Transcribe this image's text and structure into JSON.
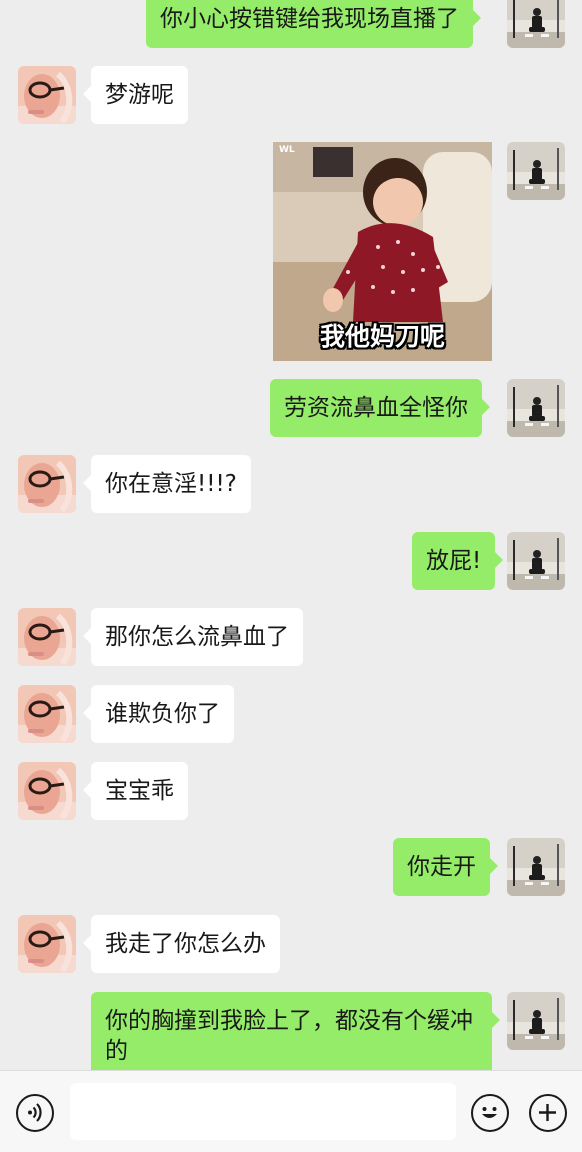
{
  "chat": {
    "messages": [
      {
        "side": "out",
        "text": "你小心按错键给我现场直播了"
      },
      {
        "side": "in",
        "text": "梦游呢"
      },
      {
        "side": "out",
        "type": "sticker",
        "caption": "我他妈刀呢",
        "watermark": "WL"
      },
      {
        "side": "out",
        "text": "劳资流鼻血全怪你"
      },
      {
        "side": "in",
        "text": "你在意淫!!!?"
      },
      {
        "side": "out",
        "text": "放屁!"
      },
      {
        "side": "in",
        "text": "那你怎么流鼻血了"
      },
      {
        "side": "in",
        "text": "谁欺负你了"
      },
      {
        "side": "in",
        "text": "宝宝乖"
      },
      {
        "side": "out",
        "text": "你走开"
      },
      {
        "side": "in",
        "text": "我走了你怎么办"
      },
      {
        "side": "out",
        "text": "你的胸撞到我脸上了，都没有个缓冲的"
      }
    ]
  },
  "input_bar": {
    "voice_icon": "voice-icon",
    "emoji_icon": "emoji-icon",
    "plus_icon": "plus-icon",
    "text_value": ""
  },
  "colors": {
    "background": "#ededed",
    "incoming_bubble": "#ffffff",
    "outgoing_bubble": "#95ec69",
    "input_bar": "#f7f7f7"
  }
}
